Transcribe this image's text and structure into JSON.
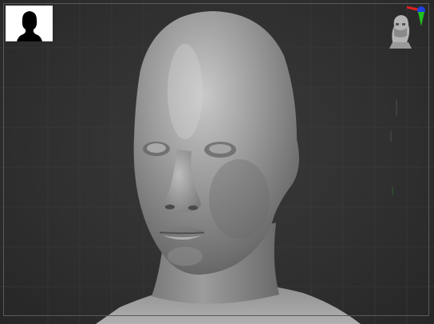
{
  "viewport": {
    "background": "#2e2e2e",
    "grid_color": "#3c3c3c",
    "frame_color": "#5a5a5a"
  },
  "thumbnail": {
    "background": "#ffffff",
    "silhouette_color": "#000000",
    "icon": "head-silhouette-icon"
  },
  "gizmo": {
    "icon": "navigation-cube-head-icon",
    "axis_colors": {
      "x": "#e02020",
      "y": "#20c020",
      "z": "#2040e0"
    }
  },
  "model": {
    "subject": "sculpted-head-bust",
    "material_color": "#8c8c8c"
  }
}
